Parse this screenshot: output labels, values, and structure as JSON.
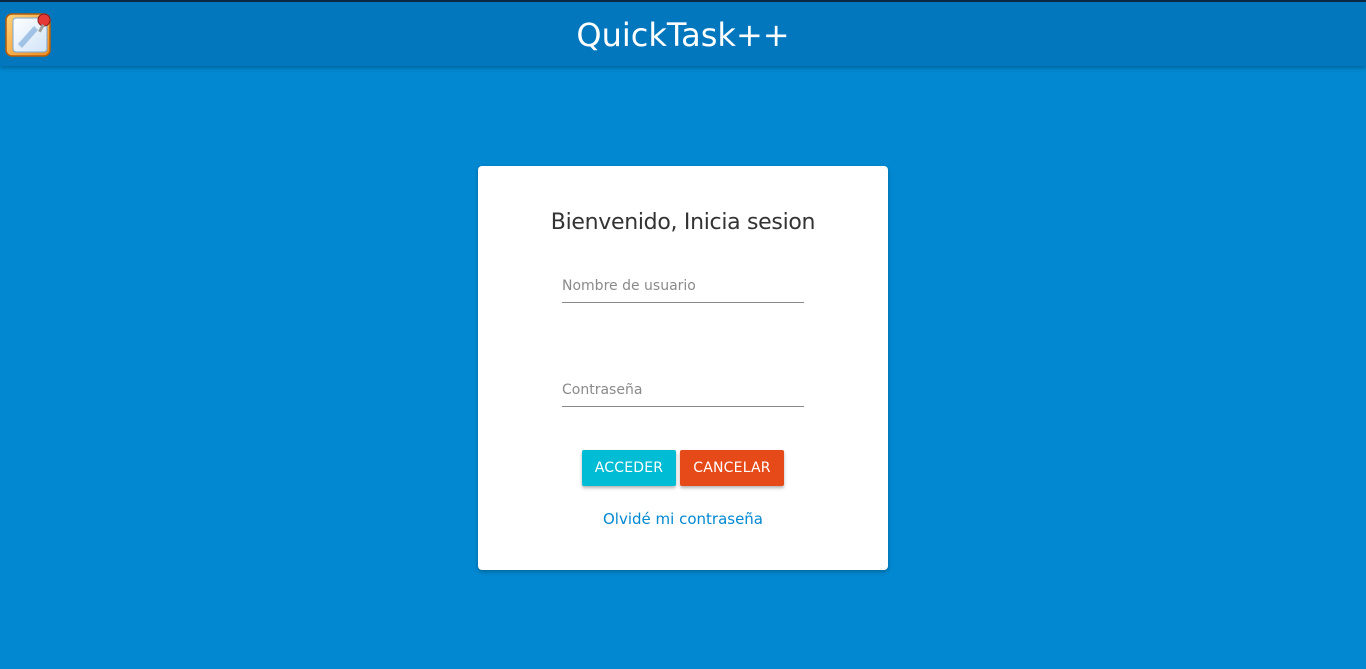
{
  "app": {
    "title": "QuickTask++",
    "logo_icon": "notepad-pin-icon"
  },
  "login": {
    "heading": "Bienvenido, Inicia sesion",
    "username": {
      "placeholder": "Nombre de usuario",
      "value": ""
    },
    "password": {
      "placeholder": "Contraseña",
      "value": ""
    },
    "submit_label": "ACCEDER",
    "cancel_label": "CANCELAR",
    "forgot_label": "Olvidé mi contraseña"
  },
  "colors": {
    "background": "#0288d1",
    "appbar": "#0277bd",
    "submit_button": "#00bcd4",
    "cancel_button": "#e64a19",
    "link": "#0288d1"
  }
}
